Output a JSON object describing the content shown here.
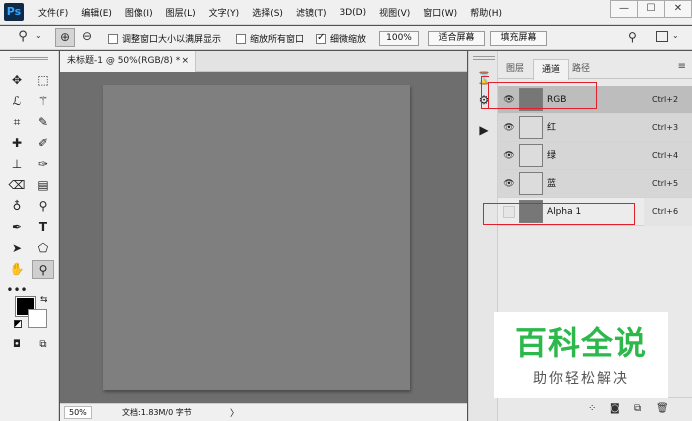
{
  "app": {
    "logo": "Ps"
  },
  "menu": [
    "文件(F)",
    "编辑(E)",
    "图像(I)",
    "图层(L)",
    "文字(Y)",
    "选择(S)",
    "滤镜(T)",
    "3D(D)",
    "视图(V)",
    "窗口(W)",
    "帮助(H)"
  ],
  "window_controls": {
    "minimize": "—",
    "maximize": "☐",
    "close": "✕"
  },
  "options": {
    "resize_windows_label": "调整窗口大小以满屏显示",
    "resize_windows_checked": false,
    "zoom_all_label": "缩放所有窗口",
    "zoom_all_checked": false,
    "scrubby_zoom_label": "细微缩放",
    "scrubby_zoom_checked": true,
    "zoom_value": "100%",
    "fit_screen_label": "适合屏幕",
    "fill_screen_label": "填充屏幕"
  },
  "document": {
    "tab_title": "未标题-1 @ 50%(RGB/8) *",
    "close_glyph": "×",
    "status_zoom": "50%",
    "status_info": "文档:1.83M/0 字节",
    "status_arrow": "〉"
  },
  "panel": {
    "tabs": [
      "图层",
      "通道",
      "路径"
    ],
    "active_tab": "通道",
    "menu_glyph": "≡",
    "channels": [
      {
        "name": "RGB",
        "shortcut": "Ctrl+2",
        "visible": true
      },
      {
        "name": "红",
        "shortcut": "Ctrl+3",
        "visible": true
      },
      {
        "name": "绿",
        "shortcut": "Ctrl+4",
        "visible": true
      },
      {
        "name": "蓝",
        "shortcut": "Ctrl+5",
        "visible": true
      },
      {
        "name": "Alpha 1",
        "shortcut": "Ctrl+6",
        "visible": false
      }
    ]
  },
  "watermark": {
    "title": "百科全说",
    "subtitle": "助你轻松解决"
  },
  "colors": {
    "highlight": "#e0202a",
    "watermark_green": "#2cb84b",
    "canvas_bg": "#6e6e6e",
    "document_fill": "#7f7f7f"
  }
}
